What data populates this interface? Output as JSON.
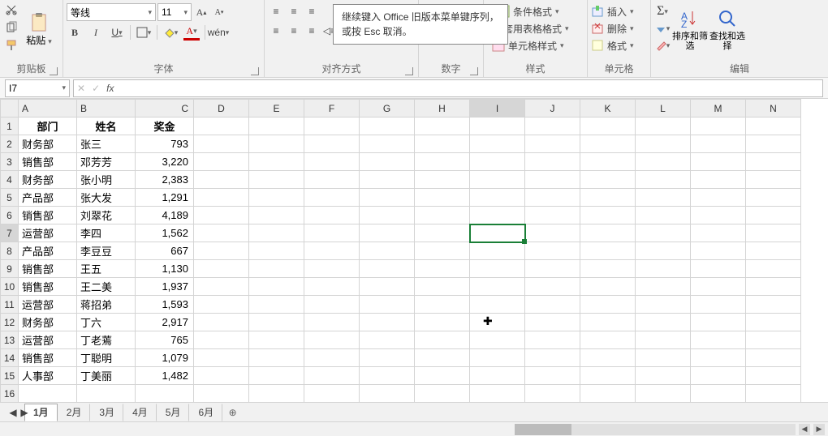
{
  "tooltip": {
    "line1": "继续键入 Office 旧版本菜单键序列，",
    "line2": "或按 Esc 取消。"
  },
  "ribbon": {
    "clipboard": {
      "paste": "粘贴",
      "label": "剪贴板"
    },
    "font": {
      "name": "等线",
      "size": "11",
      "label": "字体",
      "bold": "B",
      "italic": "I",
      "underline": "U",
      "pinyin": "wén"
    },
    "align": {
      "label": "对齐方式"
    },
    "number": {
      "label": "数字"
    },
    "styles": {
      "cond": "条件格式",
      "tablefmt": "套用表格格式",
      "cellstyle": "单元格样式",
      "label": "样式"
    },
    "cells": {
      "insert": "插入",
      "delete": "删除",
      "format": "格式",
      "label": "单元格"
    },
    "editing": {
      "sort": "排序和筛选",
      "find": "查找和选择",
      "label": "编辑"
    }
  },
  "namebox": "I7",
  "fx": "fx",
  "cols": [
    "A",
    "B",
    "C",
    "D",
    "E",
    "F",
    "G",
    "H",
    "I",
    "J",
    "K",
    "L",
    "M",
    "N"
  ],
  "header": [
    "部门",
    "姓名",
    "奖金"
  ],
  "rows": [
    [
      "财务部",
      "张三",
      "793"
    ],
    [
      "销售部",
      "邓芳芳",
      "3,220"
    ],
    [
      "财务部",
      "张小明",
      "2,383"
    ],
    [
      "产品部",
      "张大发",
      "1,291"
    ],
    [
      "销售部",
      "刘翠花",
      "4,189"
    ],
    [
      "运营部",
      "李四",
      "1,562"
    ],
    [
      "产品部",
      "李豆豆",
      "667"
    ],
    [
      "销售部",
      "王五",
      "1,130"
    ],
    [
      "销售部",
      "王二美",
      "1,937"
    ],
    [
      "运营部",
      "蒋招弟",
      "1,593"
    ],
    [
      "财务部",
      "丁六",
      "2,917"
    ],
    [
      "运营部",
      "丁老蔫",
      "765"
    ],
    [
      "销售部",
      "丁聪明",
      "1,079"
    ],
    [
      "人事部",
      "丁美丽",
      "1,482"
    ]
  ],
  "tabs": [
    "1月",
    "2月",
    "3月",
    "4月",
    "5月",
    "6月"
  ],
  "activeTab": 0,
  "sel": {
    "row": 7,
    "col": "I"
  }
}
